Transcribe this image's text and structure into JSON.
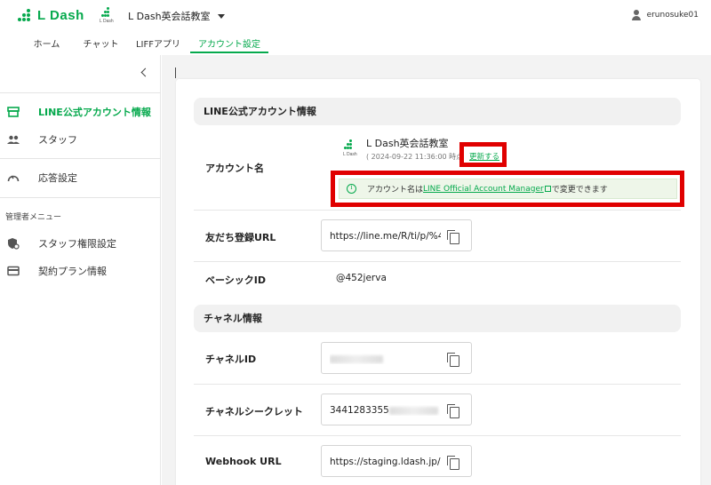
{
  "header": {
    "logo_text": "L Dash",
    "account_logo_caption": "L Dash",
    "account_name": "L Dash英会話教室",
    "user_name": "erunosuke01"
  },
  "tabs": [
    {
      "label": "ホーム",
      "active": false
    },
    {
      "label": "チャット",
      "active": false
    },
    {
      "label": "LIFFアプリ",
      "active": false
    },
    {
      "label": "アカウント設定",
      "active": true
    }
  ],
  "sidebar": {
    "items": [
      {
        "label": "LINE公式アカウント情報",
        "icon": "store-icon",
        "active": true
      },
      {
        "label": "スタッフ",
        "icon": "people-icon",
        "active": false
      },
      {
        "label": "応答設定",
        "icon": "speedometer-icon",
        "active": false
      }
    ],
    "admin_header": "管理者メニュー",
    "admin_items": [
      {
        "label": "スタッフ権限設定",
        "icon": "shield-gear-icon"
      },
      {
        "label": "契約プラン情報",
        "icon": "credit-card-icon"
      }
    ]
  },
  "account_section": {
    "title": "LINE公式アカウント情報",
    "account_name_label": "アカウント名",
    "account_name_value": "L Dash英会話教室",
    "account_logo_caption": "L Dash",
    "updated_at": "( 2024-09-22 11:36:00 時点 )",
    "update_link": "更新する",
    "info_prefix": "アカウント名は",
    "info_link": "LINE Official Account Manager",
    "info_suffix": "で変更できます",
    "friend_url_label": "友だち登録URL",
    "friend_url_value": "https://line.me/R/ti/p/%4",
    "basic_id_label": "ベーシックID",
    "basic_id_value": "@452jerva"
  },
  "channel_section": {
    "title": "チャネル情報",
    "channel_id_label": "チャネルID",
    "channel_secret_label": "チャネルシークレット",
    "channel_secret_value": "3441283355",
    "webhook_label": "Webhook URL",
    "webhook_value": "https://staging.ldash.jp/a"
  },
  "colors": {
    "brand_green": "#06a94d",
    "highlight_red": "#e00000",
    "info_background": "#eef6e9"
  }
}
